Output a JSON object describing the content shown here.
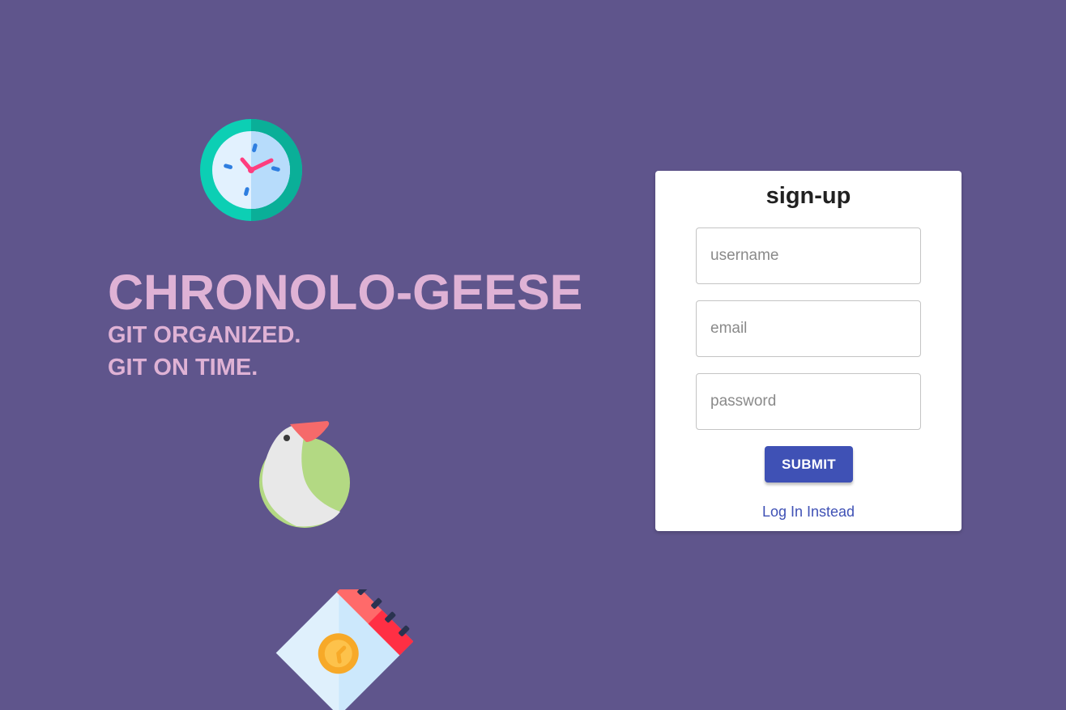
{
  "icons": {
    "clock": "clock-icon",
    "goose": "goose-icon",
    "calendar": "calendar-icon"
  },
  "hero": {
    "title": "CHRONOLO-GEESE",
    "tagline_line1": "GIT ORGANIZED.",
    "tagline_line2": "GIT ON TIME."
  },
  "signup": {
    "title": "sign-up",
    "username_placeholder": "username",
    "username_value": "",
    "email_placeholder": "email",
    "email_value": "",
    "password_placeholder": "password",
    "password_value": "",
    "submit_label": "SUBMIT",
    "login_link_label": "Log In Instead"
  },
  "colors": {
    "background": "#5f558c",
    "hero_text": "#dfb2d5",
    "primary": "#3f51b5"
  }
}
